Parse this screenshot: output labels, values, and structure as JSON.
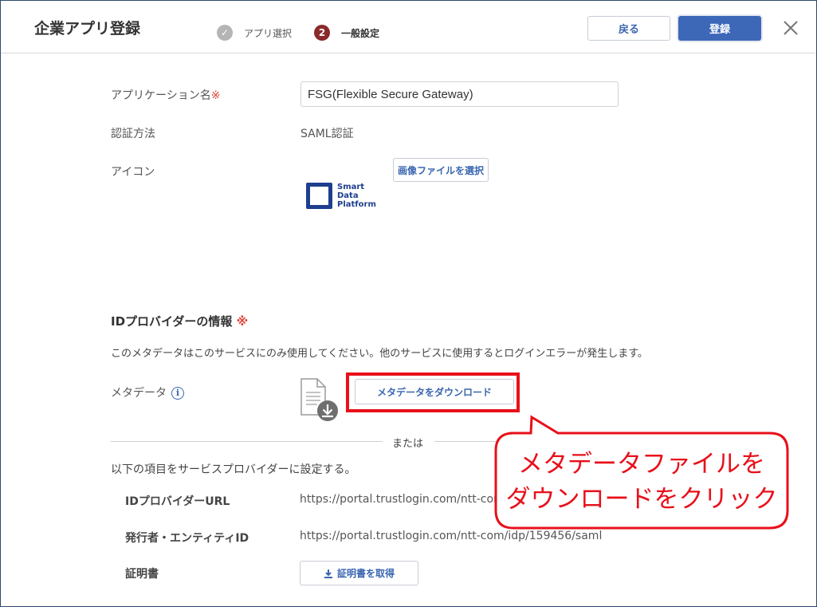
{
  "header": {
    "title": "企業アプリ登録",
    "steps": [
      {
        "number": "✓",
        "label": "アプリ選択"
      },
      {
        "number": "2",
        "label": "一般設定"
      }
    ],
    "back_label": "戻る",
    "register_label": "登録"
  },
  "form": {
    "app_name_label": "アプリケーション名",
    "required_mark": "※",
    "app_name_value": "FSG(Flexible Secure Gateway)",
    "auth_label": "認証方法",
    "auth_value": "SAML認証",
    "icon_label": "アイコン",
    "select_image_label": "画像ファイルを選択",
    "logo_lines": [
      "Smart",
      "Data",
      "Platform"
    ]
  },
  "idp": {
    "title": "IDプロバイダーの情報",
    "required_mark": "※",
    "note": "このメタデータはこのサービスにのみ使用してください。他のサービスに使用するとログインエラーが発生します。",
    "metadata_label": "メタデータ",
    "info_glyph": "i",
    "download_label": "メタデータをダウンロード",
    "or_text": "または",
    "instruction": "以下の項目をサービスプロバイダーに設定する。",
    "url_label": "IDプロバイダーURL",
    "url_value": "https://portal.trustlogin.com/ntt-com/ic",
    "entity_label": "発行者・エンティティID",
    "entity_value": "https://portal.trustlogin.com/ntt-com/idp/159456/saml",
    "cert_label": "証明書",
    "cert_button_label": "証明書を取得"
  },
  "callout": {
    "line1": "メタデータファイルを",
    "line2": "ダウンロードをクリック"
  },
  "colors": {
    "accent": "#3d68b8",
    "highlight": "#e8101a",
    "required": "#e0463b"
  }
}
